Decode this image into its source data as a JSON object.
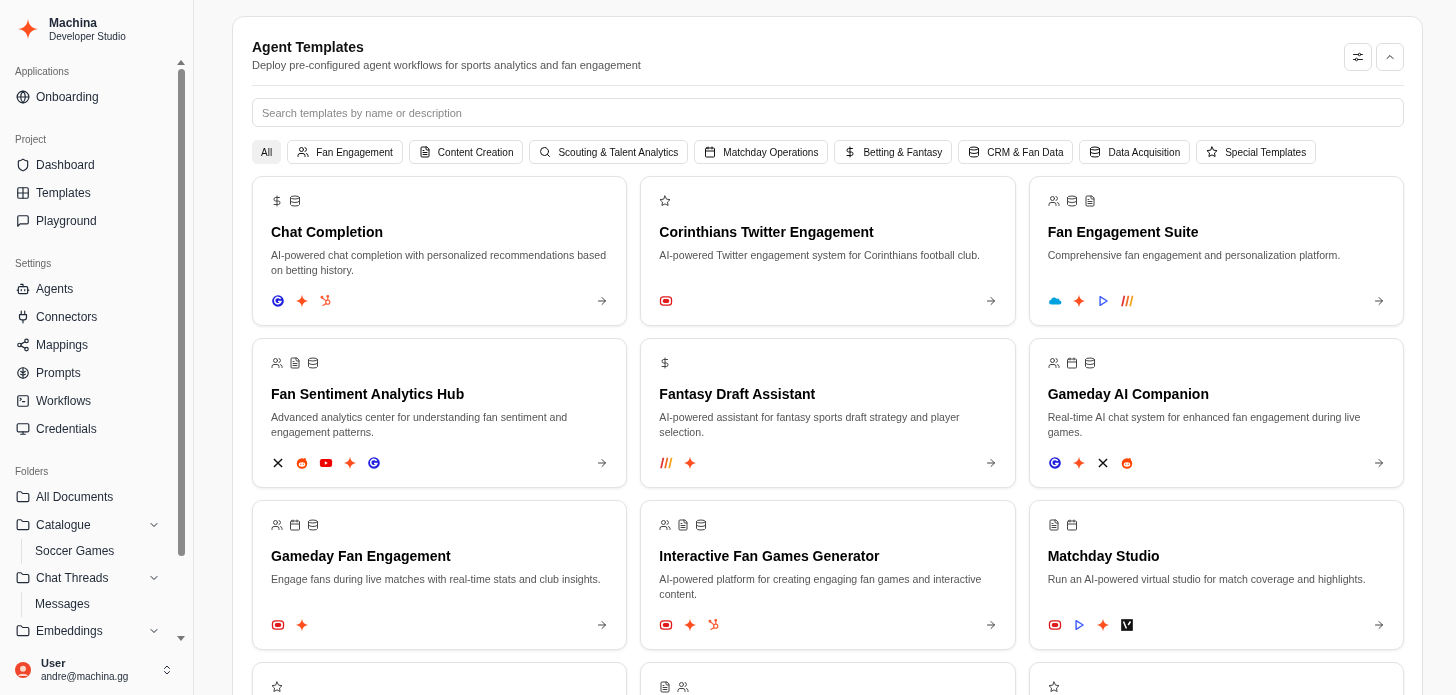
{
  "brand": {
    "name": "Machina",
    "subtitle": "Developer Studio"
  },
  "sidebar": {
    "sections": [
      {
        "label": "Applications",
        "items": [
          {
            "label": "Onboarding"
          }
        ]
      },
      {
        "label": "Project",
        "items": [
          {
            "label": "Dashboard"
          },
          {
            "label": "Templates"
          },
          {
            "label": "Playground"
          }
        ]
      },
      {
        "label": "Settings",
        "items": [
          {
            "label": "Agents"
          },
          {
            "label": "Connectors"
          },
          {
            "label": "Mappings"
          },
          {
            "label": "Prompts"
          },
          {
            "label": "Workflows"
          },
          {
            "label": "Credentials"
          }
        ]
      },
      {
        "label": "Folders",
        "items": [
          {
            "label": "All Documents"
          },
          {
            "label": "Catalogue",
            "expanded": true,
            "children": [
              {
                "label": "Soccer Games"
              }
            ]
          },
          {
            "label": "Chat Threads",
            "expanded": true,
            "children": [
              {
                "label": "Messages"
              }
            ]
          },
          {
            "label": "Embeddings",
            "expanded": true
          }
        ]
      }
    ]
  },
  "user": {
    "name": "User",
    "email": "andre@machina.gg"
  },
  "panel": {
    "title": "Agent Templates",
    "subtitle": "Deploy pre-configured agent workflows for sports analytics and fan engagement",
    "expanded": true,
    "search": {
      "placeholder": "Search templates by name or description"
    },
    "filters": [
      {
        "label": "All",
        "selected": true
      },
      {
        "label": "Fan Engagement",
        "selected": false
      },
      {
        "label": "Content Creation",
        "selected": false
      },
      {
        "label": "Scouting & Talent Analytics",
        "selected": false
      },
      {
        "label": "Matchday Operations",
        "selected": false
      },
      {
        "label": "Betting & Fantasy",
        "selected": false
      },
      {
        "label": "CRM & Fan Data",
        "selected": false
      },
      {
        "label": "Data Acquisition",
        "selected": false
      },
      {
        "label": "Special Templates",
        "selected": false
      }
    ],
    "cards": [
      {
        "title": "Chat Completion",
        "description": "AI-powered chat completion with personalized recommendations based on betting history."
      },
      {
        "title": "Corinthians Twitter Engagement",
        "description": "AI-powered Twitter engagement system for Corinthians football club."
      },
      {
        "title": "Fan Engagement Suite",
        "description": "Comprehensive fan engagement and personalization platform."
      },
      {
        "title": "Fan Sentiment Analytics Hub",
        "description": "Advanced analytics center for understanding fan sentiment and engagement patterns."
      },
      {
        "title": "Fantasy Draft Assistant",
        "description": "AI-powered assistant for fantasy sports draft strategy and player selection."
      },
      {
        "title": "Gameday AI Companion",
        "description": "Real-time AI chat system for enhanced fan engagement during live games."
      },
      {
        "title": "Gameday Fan Engagement",
        "description": "Engage fans during live matches with real-time stats and club insights."
      },
      {
        "title": "Interactive Fan Games Generator",
        "description": "AI-powered platform for creating engaging fan games and interactive content."
      },
      {
        "title": "Matchday Studio",
        "description": "Run an AI-powered virtual studio for match coverage and highlights."
      }
    ]
  }
}
